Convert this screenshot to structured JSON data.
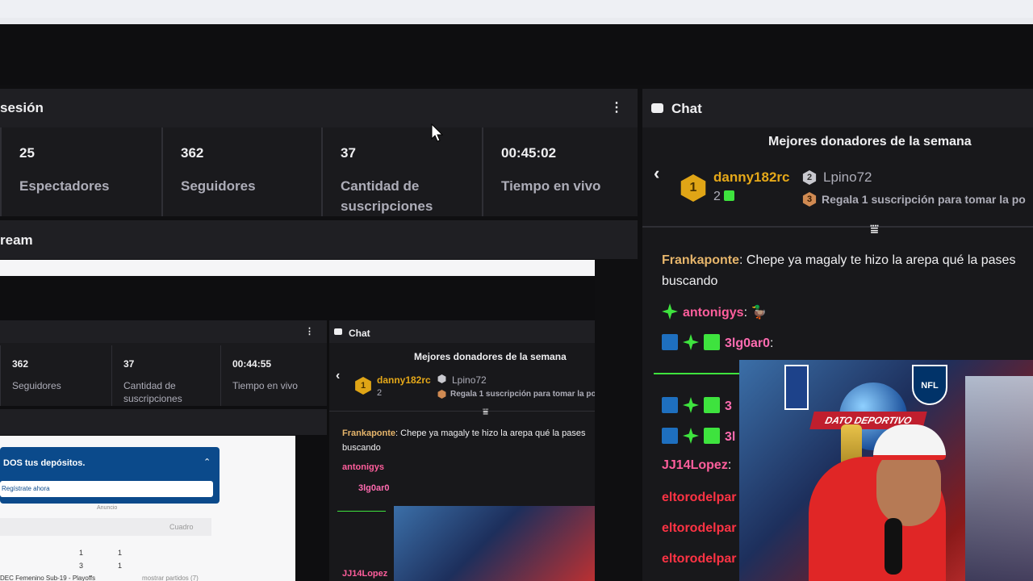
{
  "session": {
    "title": "sesión",
    "stats": [
      {
        "value": "25",
        "label": "Espectadores"
      },
      {
        "value": "362",
        "label": "Seguidores"
      },
      {
        "value": "37",
        "label": "Cantidad de suscripciones"
      },
      {
        "value": "00:45:02",
        "label": "Tiempo en vivo"
      }
    ]
  },
  "stream": {
    "title": "ream"
  },
  "chat": {
    "title": "Chat",
    "donors_title": "Mejores donadores de la semana",
    "top_donor": {
      "rank": "1",
      "name": "danny182rc",
      "count": "2"
    },
    "second_donor": {
      "rank": "2",
      "name": "Lpino72"
    },
    "third_donor": {
      "rank": "3",
      "text": "Regala 1 suscripción para tomar la po"
    },
    "messages": [
      {
        "user": "Frankaponte",
        "text": "Chepe ya magaly te hizo la arepa qué la pases",
        "cont": "buscando"
      },
      {
        "user": "antonigys",
        "text": ":"
      },
      {
        "user": "3lg0ar0",
        "text": ":"
      },
      {
        "user": "3",
        "text": ""
      },
      {
        "user": "3l",
        "text": ""
      },
      {
        "user": "JJ14Lopez",
        "text": ":"
      },
      {
        "user": "eltorodelpar",
        "text": ""
      },
      {
        "user": "eltorodelpar",
        "text": ""
      },
      {
        "user": "eltorodelpar",
        "text": ""
      }
    ]
  },
  "inner": {
    "stats": [
      {
        "value": "362",
        "label": "Seguidores"
      },
      {
        "value": "37",
        "label": "Cantidad de",
        "label2": "suscripciones"
      },
      {
        "value": "00:44:55",
        "label": "Tiempo en vivo"
      }
    ],
    "chat_title": "Chat",
    "donors_title": "Mejores donadores de la semana",
    "donor1": "danny182rc",
    "donor1_count": "2",
    "donor2": "Lpino72",
    "donor3": "Regala 1 suscripción para tomar la po",
    "msg1_user": "Frankaponte",
    "msg1_text": ": Chepe ya magaly te hizo la arepa qué la pases",
    "msg1_cont": "buscando",
    "msg2_user": "antonigys",
    "msg3_user": "3lg0ar0",
    "msg4_user": "JJ14Lopez",
    "site": {
      "deposit_title": "DOS tus depósitos.",
      "deposit_button": "Regístrate ahora",
      "anuncio": "Anuncio",
      "cuadro": "Cuadro",
      "numbers": [
        "1",
        "1",
        "3",
        "1"
      ],
      "footer": "DEC Femenino Sub-19 - Playoffs",
      "footer_right": "mostrar partidos (7)"
    }
  },
  "webcam": {
    "banner": "DATO DEPORTIVO",
    "nfl": "NFL"
  }
}
